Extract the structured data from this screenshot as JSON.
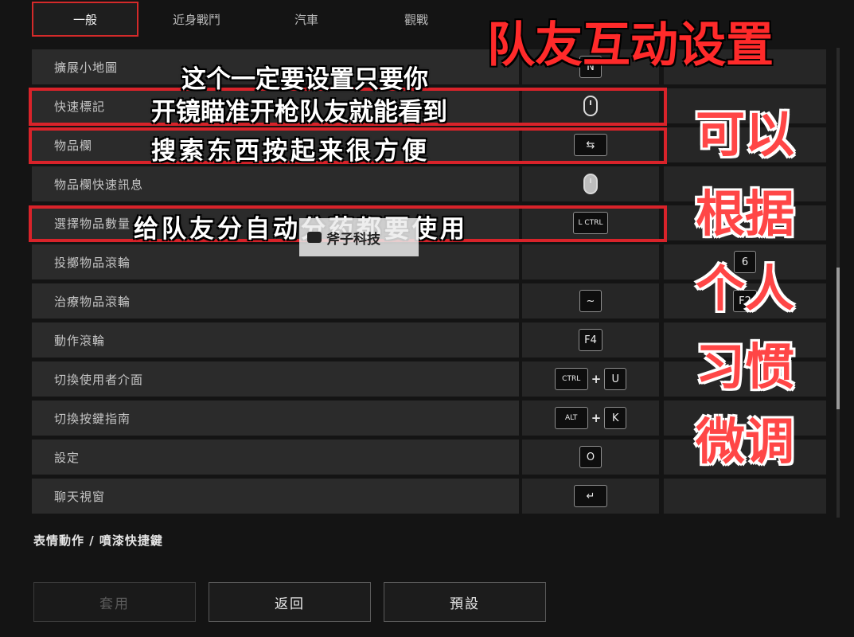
{
  "tabs": [
    {
      "label": "一般",
      "active": true
    },
    {
      "label": "近身戰鬥",
      "active": false
    },
    {
      "label": "汽車",
      "active": false
    },
    {
      "label": "觀戰",
      "active": false
    }
  ],
  "rows": [
    {
      "label": "擴展小地圖",
      "keys": [
        "N"
      ]
    },
    {
      "label": "快速標記",
      "keys": [
        "mouse-middle-icon"
      ]
    },
    {
      "label": "物品欄",
      "keys": [
        "tab-icon"
      ]
    },
    {
      "label": "物品欄快速訊息",
      "keys": [
        "mouse-button-icon"
      ]
    },
    {
      "label": "選擇物品數量",
      "keys": [
        "L CTRL"
      ]
    },
    {
      "label": "投擲物品滾輪",
      "keys": [],
      "alt_key": "6"
    },
    {
      "label": "治療物品滾輪",
      "keys": [
        "~"
      ],
      "alt_key": "F2"
    },
    {
      "label": "動作滾輪",
      "keys": [
        "F4"
      ]
    },
    {
      "label": "切換使用者介面",
      "keys": [
        "CTRL",
        "U"
      ]
    },
    {
      "label": "切換按鍵指南",
      "keys": [
        "ALT",
        "K"
      ]
    },
    {
      "label": "設定",
      "keys": [
        "O"
      ]
    },
    {
      "label": "聊天視窗",
      "keys": [
        "↵"
      ]
    }
  ],
  "section_title": "表情動作 / 噴漆快捷鍵",
  "buttons": {
    "apply": "套用",
    "back": "返回",
    "default": "預設"
  },
  "overlay": {
    "title": "队友互动设置",
    "captions": [
      "这个一定要设置只要你",
      "开镜瞄准开枪队友就能看到",
      "搜索东西按起来很方便",
      "给队友分自动分药都要使用"
    ],
    "side_lines": [
      "可以",
      "根据",
      "个人",
      "习惯",
      "微调"
    ],
    "watermark": "斧子科技"
  },
  "colors": {
    "accent_red": "#d9232a",
    "overlay_red": "#ff2a2a"
  }
}
